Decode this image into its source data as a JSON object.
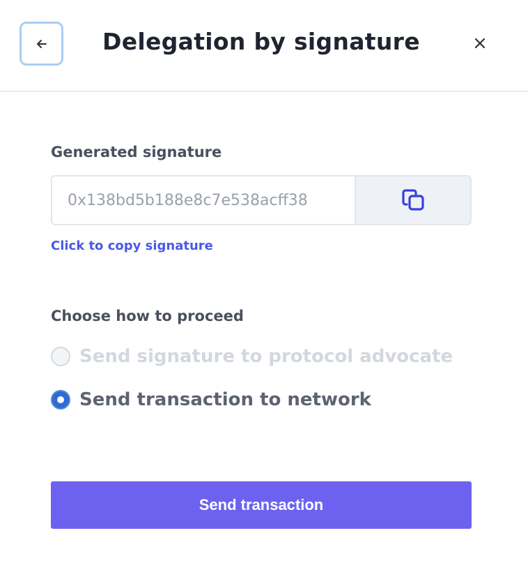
{
  "header": {
    "title": "Delegation by signature",
    "back_icon": "arrow-left-icon",
    "close_icon": "close-icon",
    "close_glyph": "×",
    "back_border_color": "#a9cdf4"
  },
  "signature": {
    "label": "Generated signature",
    "value": "0x138bd5b188e8c7e538acff38",
    "copy_icon": "copy-icon",
    "copy_link": "Click to copy signature",
    "link_color": "#4a58ea"
  },
  "proceed": {
    "label": "Choose how to proceed",
    "options": [
      {
        "label": "Send signature to protocol advocate",
        "state": "disabled"
      },
      {
        "label": "Send transaction to network",
        "state": "checked"
      }
    ]
  },
  "actions": {
    "send_label": "Send transaction",
    "accent_color": "#6d62ef"
  }
}
